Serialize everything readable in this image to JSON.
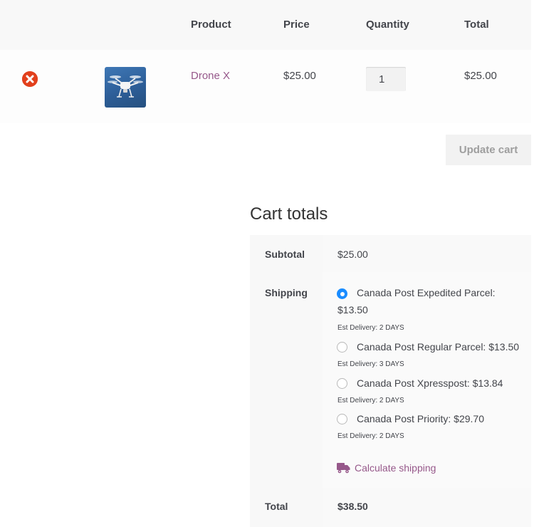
{
  "cart_table": {
    "headers": {
      "product": "Product",
      "price": "Price",
      "quantity": "Quantity",
      "total": "Total"
    },
    "row": {
      "remove_icon": "remove-icon",
      "thumbnail": "drone-thumbnail",
      "product_name": "Drone X",
      "price": "$25.00",
      "quantity": "1",
      "total": "$25.00"
    },
    "update_cart_label": "Update cart"
  },
  "cart_totals": {
    "title": "Cart totals",
    "subtotal_label": "Subtotal",
    "subtotal_value": "$25.00",
    "shipping_label": "Shipping",
    "shipping_options": [
      {
        "line1": "Canada Post Expedited Parcel:",
        "line2": "$13.50",
        "est": "Est Delivery: 2 DAYS",
        "checked": true
      },
      {
        "line1": "Canada Post Regular Parcel: $13.50",
        "est": "Est Delivery: 3 DAYS",
        "checked": false
      },
      {
        "line1": "Canada Post Xpresspost: $13.84",
        "est": "Est Delivery: 2 DAYS",
        "checked": false
      },
      {
        "line1": "Canada Post Priority: $29.70",
        "est": "Est Delivery: 2 DAYS",
        "checked": false
      }
    ],
    "calculate_shipping_label": "Calculate shipping",
    "total_label": "Total",
    "total_value": "$38.50"
  },
  "colors": {
    "accent_link": "#96588a",
    "remove_red": "#e2401c",
    "radio_checked": "#1a8cff"
  }
}
